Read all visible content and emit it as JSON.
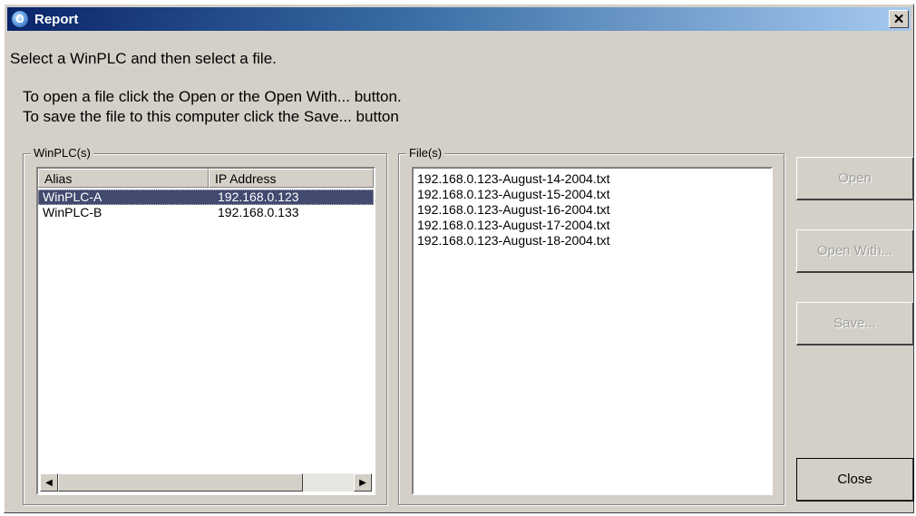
{
  "window": {
    "title": "Report"
  },
  "instructions": {
    "line1": "Select a WinPLC and then select a file.",
    "line2": "To open a file click the Open or the Open With... button.",
    "line3": "To save the file to this computer click the Save... button"
  },
  "winplc_group": {
    "label": "WinPLC(s)",
    "columns": [
      "Alias",
      "IP Address"
    ],
    "rows": [
      {
        "alias": "WinPLC-A",
        "ip": "192.168.0.123",
        "selected": true
      },
      {
        "alias": "WinPLC-B",
        "ip": "192.168.0.133",
        "selected": false
      }
    ]
  },
  "files_group": {
    "label": "File(s)",
    "items": [
      "192.168.0.123-August-14-2004.txt",
      "192.168.0.123-August-15-2004.txt",
      "192.168.0.123-August-16-2004.txt",
      "192.168.0.123-August-17-2004.txt",
      "192.168.0.123-August-18-2004.txt"
    ]
  },
  "buttons": {
    "open": "Open",
    "open_with": "Open With...",
    "save": "Save...",
    "close": "Close"
  },
  "colors": {
    "selection": "#424a70",
    "title_start": "#0a246a",
    "title_end": "#a6caf0",
    "face": "#d4d0c8"
  },
  "icons": {
    "title": "report-app-icon",
    "close": "close-icon",
    "scroll_left": "scroll-left-arrow-icon",
    "scroll_right": "scroll-right-arrow-icon"
  }
}
